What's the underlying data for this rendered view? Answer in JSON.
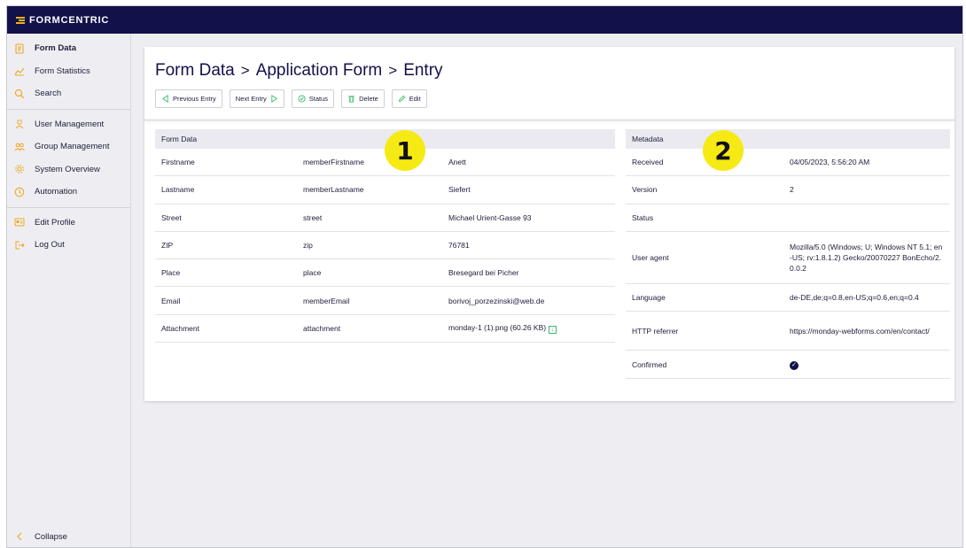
{
  "app": {
    "logo_text": "FORMCENTRIC",
    "accent": "#f0a61c",
    "brand": "#13114a",
    "success": "#3cba6c"
  },
  "sidebar": {
    "groups": [
      [
        {
          "label": "Form Data",
          "icon": "form-icon",
          "active": true
        },
        {
          "label": "Form Statistics",
          "icon": "chart-icon"
        },
        {
          "label": "Search",
          "icon": "search-icon"
        }
      ],
      [
        {
          "label": "User Management",
          "icon": "user-icon"
        },
        {
          "label": "Group Management",
          "icon": "group-icon"
        },
        {
          "label": "System Overview",
          "icon": "gear-icon"
        },
        {
          "label": "Automation",
          "icon": "clock-icon"
        }
      ],
      [
        {
          "label": "Edit Profile",
          "icon": "id-card-icon"
        },
        {
          "label": "Log Out",
          "icon": "logout-icon"
        }
      ]
    ],
    "collapse_label": "Collapse"
  },
  "breadcrumb": [
    "Form Data",
    "Application Form",
    "Entry"
  ],
  "breadcrumb_separator": ">",
  "toolbar": {
    "previous_label": "Previous Entry",
    "next_label": "Next Entry",
    "status_label": "Status",
    "delete_label": "Delete",
    "edit_label": "Edit"
  },
  "form_data": {
    "title": "Form Data",
    "rows": [
      [
        "Firstname",
        "memberFirstname",
        "Anett"
      ],
      [
        "Lastname",
        "memberLastname",
        "Siefert"
      ],
      [
        "Street",
        "street",
        "Michael Urient-Gasse 93"
      ],
      [
        "ZIP",
        "zip",
        "76781"
      ],
      [
        "Place",
        "place",
        "Bresegard bei Picher"
      ],
      [
        "Email",
        "memberEmail",
        "borivoj_porzezinski@web.de"
      ],
      [
        "Attachment",
        "attachment",
        "monday-1 (1).png (60.26 KB)"
      ]
    ]
  },
  "metadata": {
    "title": "Metadata",
    "rows": [
      [
        "Received",
        "04/05/2023, 5:56:20 AM"
      ],
      [
        "Version",
        "2"
      ],
      [
        "Status",
        ""
      ],
      [
        "User agent",
        "Mozilla/5.0 (Windows; U; Windows NT 5.1; en-US; rv:1.8.1.2) Gecko/20070227 BonEcho/2.0.0.2"
      ],
      [
        "Language",
        "de-DE,de;q=0.8,en-US;q=0.6,en;q=0.4"
      ],
      [
        "HTTP referrer",
        "https://monday-webforms.com/en/contact/"
      ],
      [
        "Confirmed",
        ""
      ]
    ]
  },
  "annotations": [
    "1",
    "2"
  ]
}
